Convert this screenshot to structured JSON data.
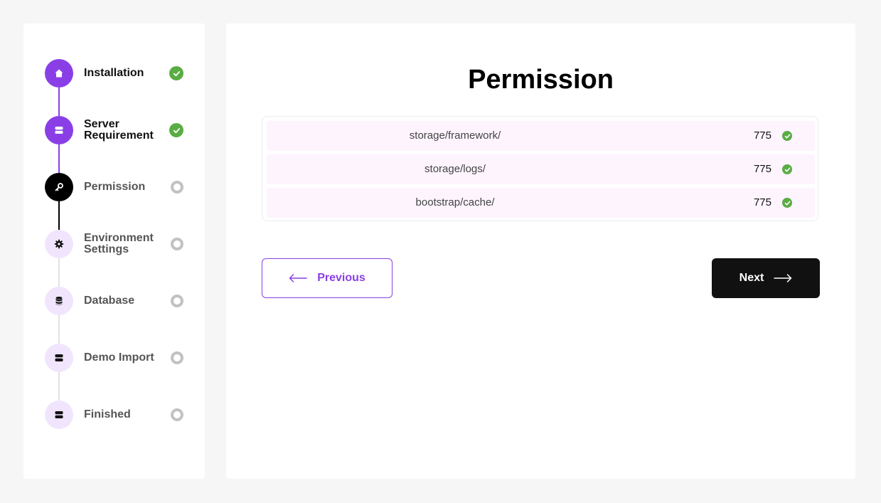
{
  "steps": [
    {
      "label": "Installation",
      "icon": "home-icon",
      "state": "done"
    },
    {
      "label": "Server Requirement",
      "icon": "server-icon",
      "state": "done"
    },
    {
      "label": "Permission",
      "icon": "key-icon",
      "state": "current"
    },
    {
      "label": "Environment Settings",
      "icon": "gear-icon",
      "state": "pending"
    },
    {
      "label": "Database",
      "icon": "database-icon",
      "state": "pending"
    },
    {
      "label": "Demo Import",
      "icon": "server-icon",
      "state": "pending"
    },
    {
      "label": "Finished",
      "icon": "server-icon",
      "state": "pending"
    }
  ],
  "main": {
    "title": "Permission",
    "permissions": [
      {
        "path": "storage/framework/",
        "value": "775",
        "status": "ok"
      },
      {
        "path": "storage/logs/",
        "value": "775",
        "status": "ok"
      },
      {
        "path": "bootstrap/cache/",
        "value": "775",
        "status": "ok"
      }
    ],
    "previous_label": "Previous",
    "next_label": "Next"
  },
  "colors": {
    "accent": "#8a3fe6",
    "success": "#5aac44",
    "pending": "#c2c2c2",
    "dark": "#111111",
    "row_bg": "#fdf4fe"
  }
}
